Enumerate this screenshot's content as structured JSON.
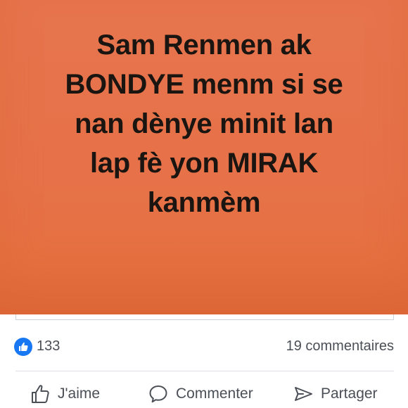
{
  "post": {
    "text_lines": [
      "Sam Renmen ak",
      "BONDYE menm si se",
      "nan dènye minit lan",
      "lap fè yon MIRAK",
      "kanmèm"
    ],
    "background_color": "#e6744c"
  },
  "stats": {
    "reaction_icon": "thumbs-up-icon",
    "reaction_count": "133",
    "comments_label": "19 commentaires"
  },
  "actions": {
    "like_label": "J'aime",
    "comment_label": "Commenter",
    "share_label": "Partager"
  },
  "colors": {
    "accent": "#1877f2",
    "text_secondary": "#4b4f56"
  }
}
